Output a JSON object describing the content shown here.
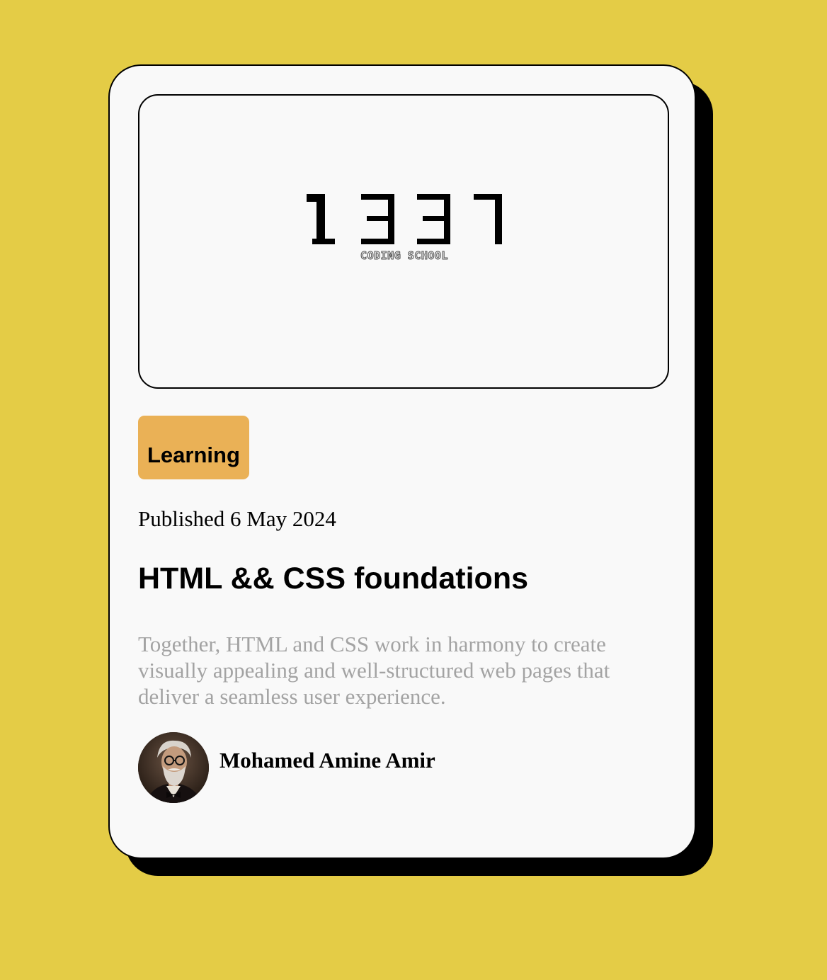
{
  "logo": {
    "digits": "1337",
    "subtitle": "CODING SCHOOL"
  },
  "tag": {
    "label": "Learning",
    "color": "#eab156"
  },
  "published": "Published 6 May 2024",
  "title": "HTML && CSS foundations",
  "description": "Together, HTML and CSS work in harmony to create visually appealing and well-structured web pages that deliver a seamless user experience.",
  "author": {
    "name": "Mohamed Amine Amir"
  },
  "colors": {
    "background": "#e4cc46",
    "card": "#f9f9f9",
    "shadow": "#000000",
    "muted_text": "#a3a3a3"
  }
}
